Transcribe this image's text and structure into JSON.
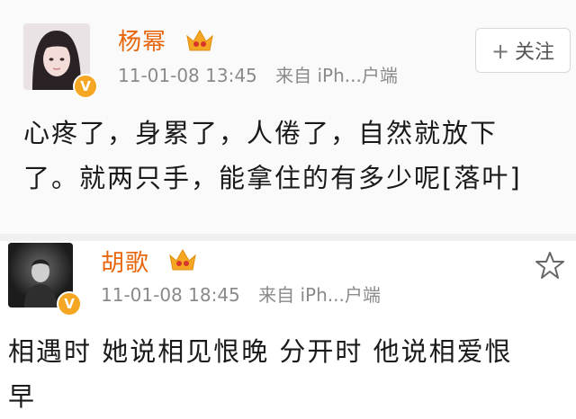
{
  "posts": [
    {
      "username": "杨幂",
      "time": "11-01-08 13:45",
      "source": "来自 iPh...户端",
      "follow_label": "关注",
      "content_lines": [
        "心疼了，身累了，人倦了，自然就放下",
        "了。就两只手，能拿住的有多少呢[落叶]"
      ]
    },
    {
      "username": "胡歌",
      "time": "11-01-08 18:45",
      "source": "来自 iPh...户端",
      "content_lines": [
        "相遇时 她说相见恨晚 分开时 他说相爱恨",
        "早"
      ]
    }
  ],
  "colors": {
    "username": "#e8660c",
    "meta": "#8a8a8a",
    "vip_badge": "#f5a623",
    "crown": "#f5a623"
  },
  "icons": [
    "plus-icon",
    "star-icon",
    "crown-icon",
    "verified-icon"
  ]
}
